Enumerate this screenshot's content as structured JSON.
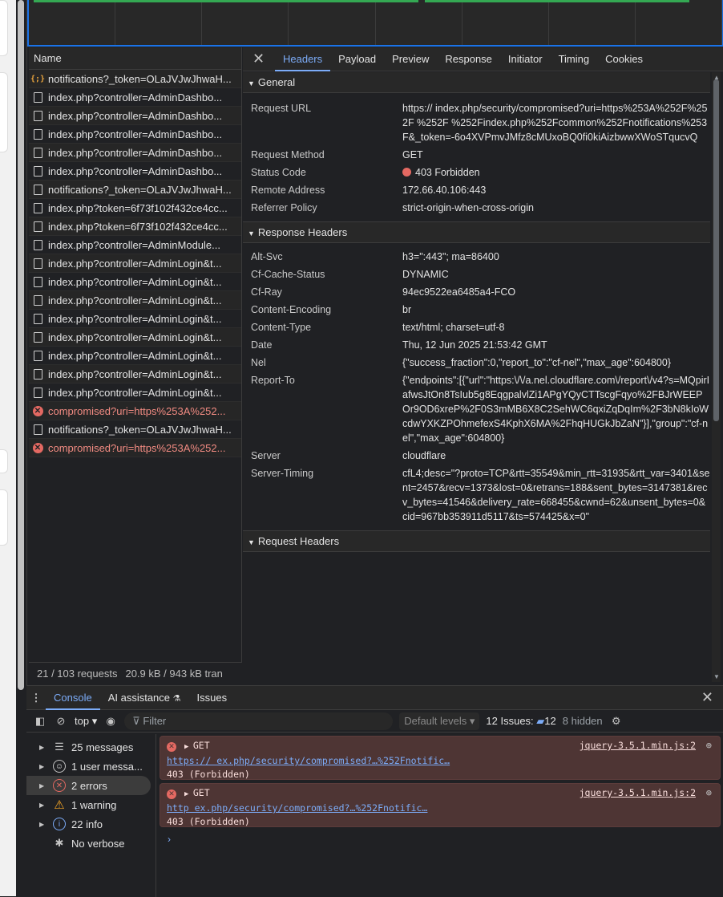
{
  "network": {
    "name_header": "Name",
    "requests": [
      {
        "name": "notifications?_token=OLaJVJwJhwaH...",
        "type": "xhr",
        "error": false
      },
      {
        "name": "index.php?controller=AdminDashbo...",
        "type": "doc",
        "error": false
      },
      {
        "name": "index.php?controller=AdminDashbo...",
        "type": "doc",
        "error": false
      },
      {
        "name": "index.php?controller=AdminDashbo...",
        "type": "doc",
        "error": false
      },
      {
        "name": "index.php?controller=AdminDashbo...",
        "type": "doc",
        "error": false
      },
      {
        "name": "index.php?controller=AdminDashbo...",
        "type": "doc",
        "error": false
      },
      {
        "name": "notifications?_token=OLaJVJwJhwaH...",
        "type": "doc",
        "error": false
      },
      {
        "name": "index.php?token=6f73f102f432ce4cc...",
        "type": "doc",
        "error": false
      },
      {
        "name": "index.php?token=6f73f102f432ce4cc...",
        "type": "doc",
        "error": false
      },
      {
        "name": "index.php?controller=AdminModule...",
        "type": "doc",
        "error": false
      },
      {
        "name": "index.php?controller=AdminLogin&t...",
        "type": "doc",
        "error": false
      },
      {
        "name": "index.php?controller=AdminLogin&t...",
        "type": "doc",
        "error": false
      },
      {
        "name": "index.php?controller=AdminLogin&t...",
        "type": "doc",
        "error": false
      },
      {
        "name": "index.php?controller=AdminLogin&t...",
        "type": "doc",
        "error": false
      },
      {
        "name": "index.php?controller=AdminLogin&t...",
        "type": "doc",
        "error": false
      },
      {
        "name": "index.php?controller=AdminLogin&t...",
        "type": "doc",
        "error": false
      },
      {
        "name": "index.php?controller=AdminLogin&t...",
        "type": "doc",
        "error": false
      },
      {
        "name": "index.php?controller=AdminLogin&t...",
        "type": "doc",
        "error": false
      },
      {
        "name": "compromised?uri=https%253A%252...",
        "type": "err",
        "error": true
      },
      {
        "name": "notifications?_token=OLaJVJwJhwaH...",
        "type": "doc",
        "error": false
      },
      {
        "name": "compromised?uri=https%253A%252...",
        "type": "err",
        "error": true
      }
    ],
    "status": {
      "requests": "21 / 103 requests",
      "transferred": "20.9 kB / 943 kB tran"
    }
  },
  "detail": {
    "tabs": [
      "Headers",
      "Payload",
      "Preview",
      "Response",
      "Initiator",
      "Timing",
      "Cookies"
    ],
    "active_tab": "Headers",
    "general": {
      "title": "General",
      "rows": [
        {
          "k": "Request URL",
          "v": "https://                                 index.php/security/compromised?uri=https%253A%252F%252F                         %252F                %252Findex.php%252Fcommon%252Fnotifications%253F&_token=-6o4XVPmvJMfz8cMUxoBQ0fi0kiAizbwwXWoSTqucvQ"
        },
        {
          "k": "Request Method",
          "v": "GET"
        },
        {
          "k": "Status Code",
          "v": "403 Forbidden"
        },
        {
          "k": "Remote Address",
          "v": "172.66.40.106:443"
        },
        {
          "k": "Referrer Policy",
          "v": "strict-origin-when-cross-origin"
        }
      ]
    },
    "response": {
      "title": "Response Headers",
      "rows": [
        {
          "k": "Alt-Svc",
          "v": "h3=\":443\"; ma=86400"
        },
        {
          "k": "Cf-Cache-Status",
          "v": "DYNAMIC"
        },
        {
          "k": "Cf-Ray",
          "v": "94ec9522ea6485a4-FCO"
        },
        {
          "k": "Content-Encoding",
          "v": "br"
        },
        {
          "k": "Content-Type",
          "v": "text/html; charset=utf-8"
        },
        {
          "k": "Date",
          "v": "Thu, 12 Jun 2025 21:53:42 GMT"
        },
        {
          "k": "Nel",
          "v": "{\"success_fraction\":0,\"report_to\":\"cf-nel\",\"max_age\":604800}"
        },
        {
          "k": "Report-To",
          "v": "{\"endpoints\":[{\"url\":\"https:\\/\\/a.nel.cloudflare.com\\/report\\/v4?s=MQpirIafwsJtOn8TsIub5g8EqgpalvlZi1APgYQyCTTscgFqyo%2FBJrWEEPOr9OD6xreP%2F0S3mMB6X8C2SehWC6qxiZqDqIm%2F3bN8kIoWcdwYXKZPOhmefexS4KphX6MA%2FhqHUGkJbZaN\"}],\"group\":\"cf-nel\",\"max_age\":604800}"
        },
        {
          "k": "Server",
          "v": "cloudflare"
        },
        {
          "k": "Server-Timing",
          "v": "cfL4;desc=\"?proto=TCP&rtt=35549&min_rtt=31935&rtt_var=3401&sent=2457&recv=1373&lost=0&retrans=188&sent_bytes=3147381&recv_bytes=41546&delivery_rate=668455&cwnd=62&unsent_bytes=0&cid=967bb353911d5117&ts=574425&x=0\""
        }
      ]
    },
    "request": {
      "title": "Request Headers"
    }
  },
  "console": {
    "tabs": [
      "Console",
      "AI assistance",
      "Issues"
    ],
    "context": "top",
    "filter_placeholder": "Filter",
    "levels": "Default levels",
    "issues": "12 Issues:",
    "issues_count": "12",
    "hidden": "8 hidden",
    "sidebar": [
      {
        "label": "25 messages",
        "icon": "list-icon"
      },
      {
        "label": "1 user messa...",
        "icon": "user-icon"
      },
      {
        "label": "2 errors",
        "icon": "error-icon"
      },
      {
        "label": "1 warning",
        "icon": "warning-icon"
      },
      {
        "label": "22 info",
        "icon": "info-icon"
      },
      {
        "label": "No verbose",
        "icon": "bug-icon"
      }
    ],
    "messages": [
      {
        "method": "GET",
        "source": "jquery-3.5.1.min.js:2",
        "url": "https://                                     ex.php/security/compromised?…%252Fnotific…",
        "status": "403 (Forbidden)"
      },
      {
        "method": "GET",
        "source": "jquery-3.5.1.min.js:2",
        "url": "http                                         ex.php/security/compromised?…%252Fnotific…",
        "status": "403 (Forbidden)"
      }
    ]
  },
  "colors": {
    "accent": "#7cacf8",
    "error": "#e46962",
    "bg": "#202124"
  }
}
